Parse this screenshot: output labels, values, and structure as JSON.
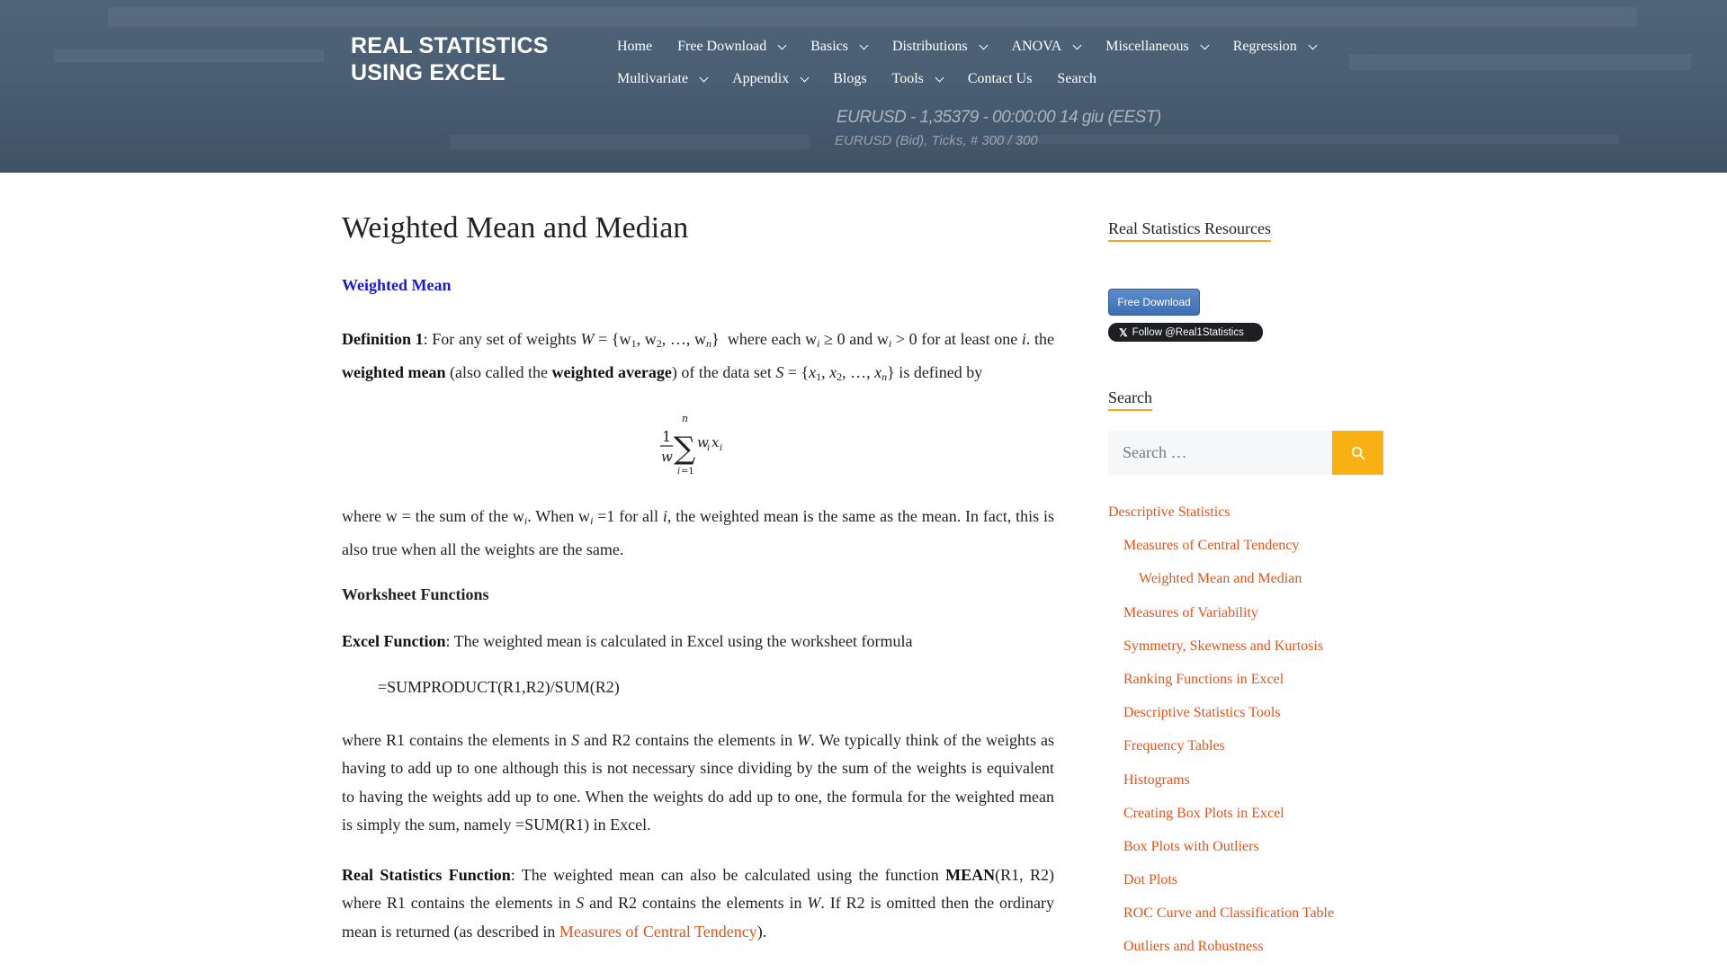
{
  "header": {
    "site_title": "REAL STATISTICS USING EXCEL",
    "background_ticker": "EURUSD - 1,35379 - 00:00:00  14 giu (EEST)",
    "background_ticker_2": "EURUSD (Bid), Ticks, # 300 / 300",
    "nav_row1": [
      {
        "label": "Home",
        "dropdown": false
      },
      {
        "label": "Free Download",
        "dropdown": true
      },
      {
        "label": "Basics",
        "dropdown": true
      },
      {
        "label": "Distributions",
        "dropdown": true
      },
      {
        "label": "ANOVA",
        "dropdown": true
      },
      {
        "label": "Miscellaneous",
        "dropdown": true
      },
      {
        "label": "Regression",
        "dropdown": true
      }
    ],
    "nav_row2": [
      {
        "label": "Multivariate",
        "dropdown": true
      },
      {
        "label": "Appendix",
        "dropdown": true
      },
      {
        "label": "Blogs",
        "dropdown": false
      },
      {
        "label": "Tools",
        "dropdown": true
      },
      {
        "label": "Contact Us",
        "dropdown": false
      },
      {
        "label": "Search",
        "dropdown": false
      }
    ]
  },
  "article": {
    "title": "Weighted Mean and Median",
    "section_heading": "Weighted Mean",
    "worksheet_heading": "Worksheet Functions",
    "formula_excel": "=SUMPRODUCT(R1,R2)/SUM(R2)",
    "link_measures": "Measures of Central Tendency"
  },
  "sidebar": {
    "resources_title": "Real Statistics Resources",
    "download_button": "Free Download",
    "follow_button": "Follow @Real1Statistics",
    "search_title": "Search",
    "search_placeholder": "Search …",
    "toc": [
      {
        "label": "Descriptive Statistics",
        "level": 1
      },
      {
        "label": "Measures of Central Tendency",
        "level": 2
      },
      {
        "label": "Weighted Mean and Median",
        "level": 3
      },
      {
        "label": "Measures of Variability",
        "level": 2
      },
      {
        "label": "Symmetry, Skewness and Kurtosis",
        "level": 2
      },
      {
        "label": "Ranking Functions in Excel",
        "level": 2
      },
      {
        "label": "Descriptive Statistics Tools",
        "level": 2
      },
      {
        "label": "Frequency Tables",
        "level": 2
      },
      {
        "label": "Histograms",
        "level": 2
      },
      {
        "label": "Creating Box Plots in Excel",
        "level": 2
      },
      {
        "label": "Box Plots with Outliers",
        "level": 2
      },
      {
        "label": "Dot Plots",
        "level": 2
      },
      {
        "label": "ROC Curve and Classification Table",
        "level": 2
      },
      {
        "label": "Outliers and Robustness",
        "level": 2
      }
    ]
  },
  "colors": {
    "header_bg": "#4a5e74",
    "link": "#e0541c",
    "section_heading": "#1a1ad4",
    "search_button": "#f8b012",
    "widget_underline": "#f5a623"
  }
}
